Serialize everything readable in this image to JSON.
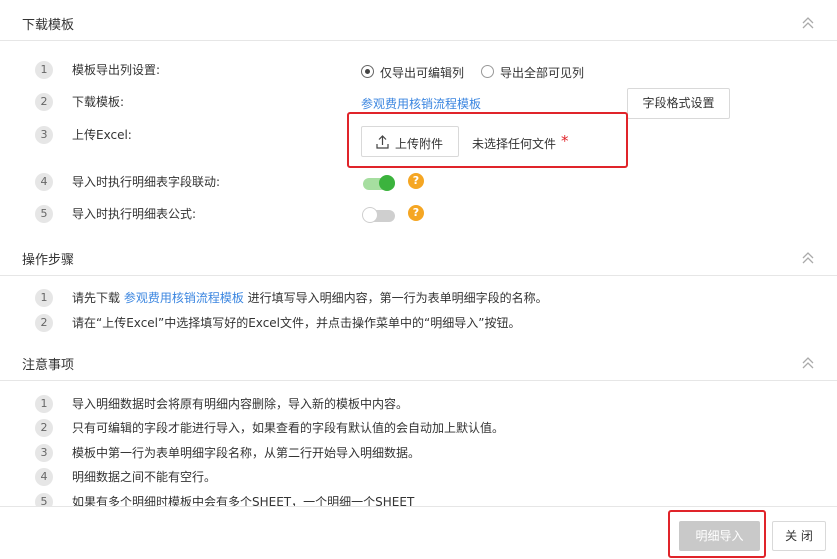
{
  "sections": {
    "download": {
      "title": "下载模板"
    },
    "steps": {
      "title": "操作步骤"
    },
    "notes": {
      "title": "注意事项"
    }
  },
  "download_rows": [
    {
      "num": "1",
      "label": "模板导出列设置:"
    },
    {
      "num": "2",
      "label": "下载模板:"
    },
    {
      "num": "3",
      "label": "上传Excel:"
    },
    {
      "num": "4",
      "label": "导入时执行明细表字段联动:"
    },
    {
      "num": "5",
      "label": "导入时执行明细表公式:"
    }
  ],
  "export_options": {
    "editable": "仅导出可编辑列",
    "all_visible": "导出全部可见列",
    "selected": "仅导出可编辑列"
  },
  "template_link": "参观费用核销流程模板",
  "field_format_button": "字段格式设置",
  "upload": {
    "button": "上传附件",
    "status": "未选择任何文件",
    "required_mark": "*"
  },
  "toggles": {
    "field_linkage": true,
    "formula": false
  },
  "help_glyph": "?",
  "steps": [
    {
      "num": "1",
      "prefix": "请先下载 ",
      "link": "参观费用核销流程模板",
      "suffix": " 进行填写导入明细内容，第一行为表单明细字段的名称。"
    },
    {
      "num": "2",
      "text": "请在“上传Excel”中选择填写好的Excel文件，并点击操作菜单中的“明细导入”按钮。"
    }
  ],
  "notes": [
    {
      "num": "1",
      "text": "导入明细数据时会将原有明细内容删除，导入新的模板中内容。"
    },
    {
      "num": "2",
      "text": "只有可编辑的字段才能进行导入，如果查看的字段有默认值的会自动加上默认值。"
    },
    {
      "num": "3",
      "text": "模板中第一行为表单明细字段名称，从第二行开始导入明细数据。"
    },
    {
      "num": "4",
      "text": "明细数据之间不能有空行。"
    },
    {
      "num": "5",
      "text": "如果有多个明细时模板中会有多个SHEET，一个明细一个SHEET"
    }
  ],
  "footer": {
    "import_button": "明细导入",
    "close_button": "关 闭"
  },
  "colors": {
    "link": "#3b86e0",
    "highlight_border": "#e0242a",
    "toggle_on": "#3bb33d",
    "help": "#f5a623"
  }
}
